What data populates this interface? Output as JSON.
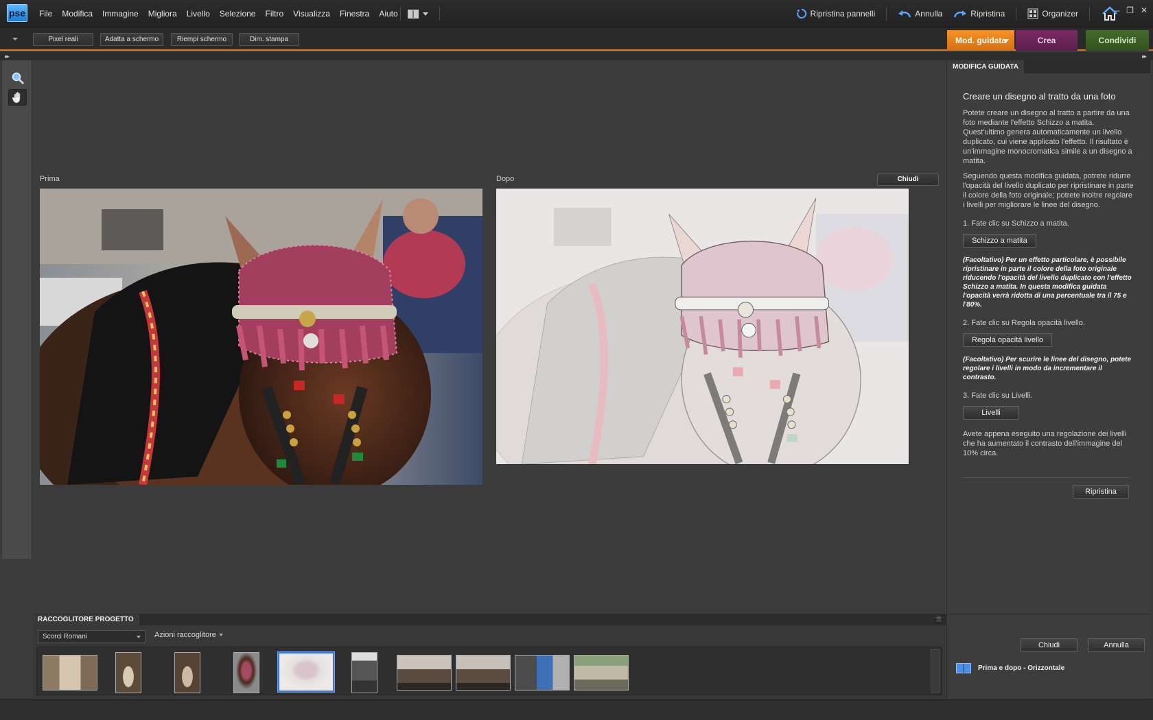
{
  "app": {
    "logo": "pse"
  },
  "menu": [
    "File",
    "Modifica",
    "Immagine",
    "Migliora",
    "Livello",
    "Selezione",
    "Filtro",
    "Visualizza",
    "Finestra",
    "Aiuto"
  ],
  "toolbar": {
    "reset_panels": "Ripristina pannelli",
    "undo": "Annulla",
    "redo": "Ripristina",
    "organizer": "Organizer"
  },
  "options": {
    "actual_pixels": "Pixel reali",
    "fit_screen": "Adatta a schermo",
    "fill_screen": "Riempi schermo",
    "print_size": "Dim. stampa"
  },
  "modes": {
    "guided": "Mod. guidata",
    "create": "Crea",
    "share": "Condividi"
  },
  "workspace": {
    "before_label": "Prima",
    "after_label": "Dopo",
    "close_label": "Chiudi"
  },
  "bin": {
    "title": "RACCOGLITORE PROGETTO",
    "album": "Scorci Romani",
    "actions": "Azioni raccoglitore",
    "thumbnails": [
      {
        "kind": "street"
      },
      {
        "kind": "arch"
      },
      {
        "kind": "arch"
      },
      {
        "kind": "horse"
      },
      {
        "kind": "sketch",
        "selected": true
      },
      {
        "kind": "carriage"
      },
      {
        "kind": "street2"
      },
      {
        "kind": "street2"
      },
      {
        "kind": "carriage2"
      },
      {
        "kind": "people"
      }
    ]
  },
  "panel": {
    "tab": "MODIFICA GUIDATA",
    "title": "Creare un disegno al tratto da una foto",
    "intro1": "Potete creare un disegno al tratto a partire da una foto mediante l'effetto Schizzo a matita. Quest'ultimo genera automaticamente un livello duplicato, cui viene applicato l'effetto. Il risultato è un'immagine monocromatica simile a un disegno a matita.",
    "intro2": "Seguendo questa modifica guidata, potrete ridurre l'opacità del livello duplicato per ripristinare in parte il colore della foto originale; potrete inoltre regolare i livelli per migliorare le linee del disegno.",
    "step1": "1. Fate clic su Schizzo a matita.",
    "step1_button": "Schizzo a matita",
    "note1": "(Facoltativo) Per un effetto particolare, è possibile ripristinare in parte il colore della foto originale riducendo l'opacità del livello duplicato con l'effetto Schizzo a matita. In questa modifica guidata l'opacità verrà ridotta di una percentuale tra il 75 e l'80%.",
    "step2": "2. Fate clic su Regola opacità livello.",
    "step2_button": "Regola opacità livello",
    "note2": "(Facoltativo) Per scurire le linee del disegno, potete regolare i livelli in modo da incrementare il contrasto.",
    "step3": "3. Fate clic su Livelli.",
    "step3_button": "Livelli",
    "outro": "Avete appena eseguito una regolazione dei livelli che ha aumentato il contrasto dell'immagine del 10% circa.",
    "reset_button": "Ripristina",
    "done_button": "Chiudi",
    "cancel_button": "Annulla",
    "view_option": "Prima e dopo - Orizzontale"
  }
}
